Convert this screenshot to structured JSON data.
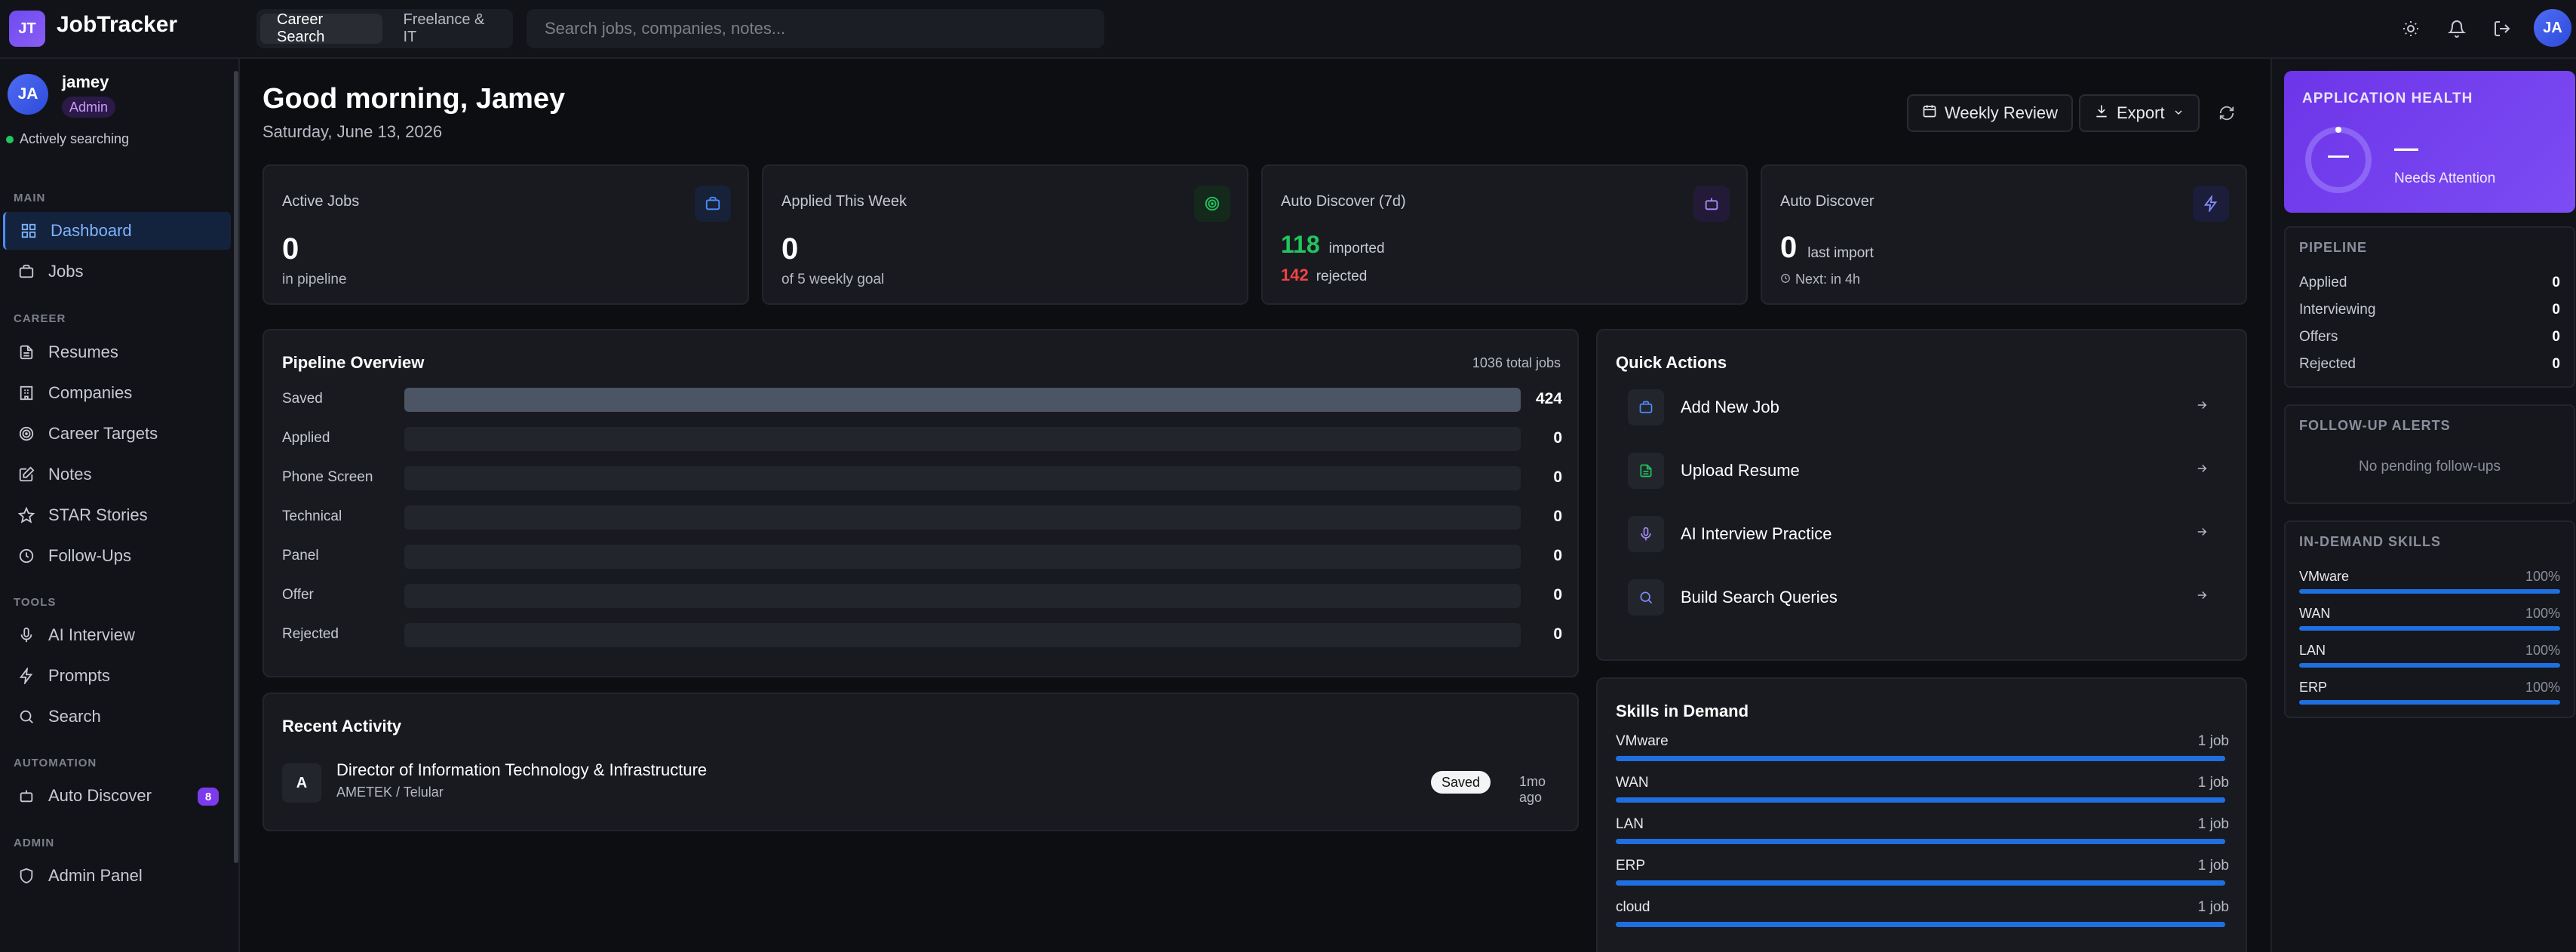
{
  "app": {
    "logo": "JT",
    "title": "JobTracker"
  },
  "topbar": {
    "modes": [
      {
        "label": "Career Search"
      },
      {
        "label": "Freelance & IT"
      }
    ],
    "search_placeholder": "Search jobs, companies, notes...",
    "user_initials": "JA",
    "icons": [
      "sun-icon",
      "bell-icon",
      "logout-icon"
    ]
  },
  "sidebar": {
    "user": {
      "initials": "JA",
      "name": "jamey",
      "role": "Admin",
      "status": "Actively searching"
    },
    "sections": {
      "main": "MAIN",
      "career": "CAREER",
      "tools": "TOOLS",
      "automation": "AUTOMATION",
      "admin": "ADMIN"
    },
    "items": {
      "dashboard": "Dashboard",
      "jobs": "Jobs",
      "resumes": "Resumes",
      "companies": "Companies",
      "career_targets": "Career Targets",
      "notes": "Notes",
      "star_stories": "STAR Stories",
      "follow_ups": "Follow-Ups",
      "ai_interview": "AI Interview",
      "prompts": "Prompts",
      "search": "Search",
      "auto_discover": "Auto Discover",
      "auto_discover_count": "8",
      "admin_panel": "Admin Panel"
    }
  },
  "header": {
    "greeting": "Good morning, Jamey",
    "date": "Saturday, June 13, 2026",
    "weekly_review": "Weekly Review",
    "export": "Export"
  },
  "stats": {
    "active_jobs": {
      "label": "Active Jobs",
      "value": "0",
      "sub": "in pipeline"
    },
    "applied_week": {
      "label": "Applied This Week",
      "value": "0",
      "sub": "of 5 weekly goal"
    },
    "auto_discover_7d": {
      "label": "Auto Discover (7d)",
      "imported": "118",
      "imported_label": "imported",
      "rejected": "142",
      "rejected_label": "rejected"
    },
    "auto_discover": {
      "label": "Auto Discover",
      "value": "0",
      "value_label": "last import",
      "next": "Next: in 4h"
    }
  },
  "pipeline": {
    "title": "Pipeline Overview",
    "total": "1036 total jobs",
    "stages": [
      {
        "label": "Saved",
        "count": "424",
        "fraction": 1.0
      },
      {
        "label": "Applied",
        "count": "0",
        "fraction": 0
      },
      {
        "label": "Phone Screen",
        "count": "0",
        "fraction": 0
      },
      {
        "label": "Technical",
        "count": "0",
        "fraction": 0
      },
      {
        "label": "Panel",
        "count": "0",
        "fraction": 0
      },
      {
        "label": "Offer",
        "count": "0",
        "fraction": 0
      },
      {
        "label": "Rejected",
        "count": "0",
        "fraction": 0
      }
    ]
  },
  "quick_actions": {
    "title": "Quick Actions",
    "items": [
      {
        "label": "Add New Job",
        "icon": "briefcase-icon"
      },
      {
        "label": "Upload Resume",
        "icon": "file-icon"
      },
      {
        "label": "AI Interview Practice",
        "icon": "mic-icon"
      },
      {
        "label": "Build Search Queries",
        "icon": "search-icon"
      }
    ]
  },
  "recent_activity": {
    "title": "Recent Activity",
    "items": [
      {
        "initial": "A",
        "title": "Director of Information Technology & Infrastructure",
        "company": "AMETEK / Telular",
        "status": "Saved",
        "time": "1mo ago"
      }
    ]
  },
  "skills_demand": {
    "title": "Skills in Demand",
    "items": [
      {
        "name": "VMware",
        "count": "1 job",
        "fraction": 1.0
      },
      {
        "name": "WAN",
        "count": "1 job",
        "fraction": 1.0
      },
      {
        "name": "LAN",
        "count": "1 job",
        "fraction": 1.0
      },
      {
        "name": "ERP",
        "count": "1 job",
        "fraction": 1.0
      },
      {
        "name": "cloud",
        "count": "1 job",
        "fraction": 1.0
      }
    ]
  },
  "right_panel": {
    "health": {
      "title": "APPLICATION HEALTH",
      "value": "—",
      "status": "Needs Attention"
    },
    "pipeline": {
      "title": "PIPELINE",
      "rows": [
        {
          "label": "Applied",
          "value": "0"
        },
        {
          "label": "Interviewing",
          "value": "0"
        },
        {
          "label": "Offers",
          "value": "0"
        },
        {
          "label": "Rejected",
          "value": "0"
        }
      ]
    },
    "follow_up": {
      "title": "FOLLOW-UP ALERTS",
      "empty": "No pending follow-ups"
    },
    "skills": {
      "title": "IN-DEMAND SKILLS",
      "items": [
        {
          "name": "VMware",
          "pct": "100%"
        },
        {
          "name": "WAN",
          "pct": "100%"
        },
        {
          "name": "LAN",
          "pct": "100%"
        },
        {
          "name": "ERP",
          "pct": "100%"
        }
      ]
    }
  },
  "colors": {
    "accent": "#7c3aed",
    "link": "#4d8dff",
    "success": "#22c55e",
    "danger": "#ef4444",
    "bar": "#1f6fe0"
  }
}
